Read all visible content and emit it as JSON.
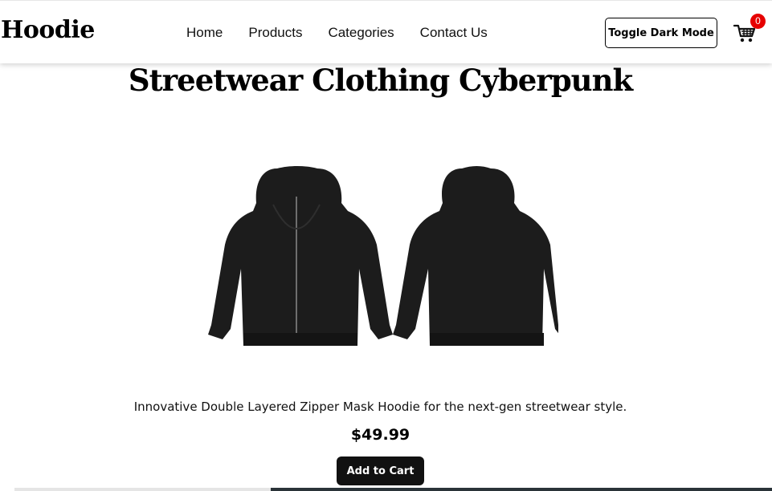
{
  "navbar": {
    "brand": "Hoodie",
    "links": [
      "Home",
      "Products",
      "Categories",
      "Contact Us"
    ],
    "toggle_label": "Toggle Dark Mode",
    "cart_icon": "cart-icon",
    "cart_count": "0"
  },
  "product": {
    "title": "Streetwear Clothing Cyberpunk",
    "image_icon": "hoodie-image",
    "description": "Innovative Double Layered Zipper Mask Hoodie for the next-gen streetwear style.",
    "price": "$49.99",
    "add_to_cart_label": "Add to Cart"
  },
  "colors": {
    "badge": "#e60000",
    "button": "#111111",
    "garment": "#1c1c1c"
  }
}
